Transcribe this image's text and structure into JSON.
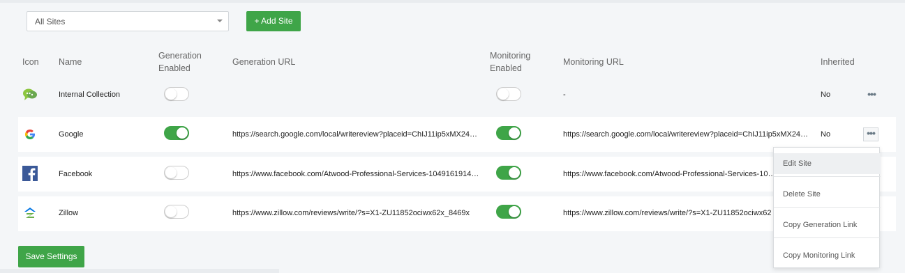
{
  "filter": {
    "selected": "All Sites"
  },
  "toolbar": {
    "add_site_label": "+ Add Site",
    "save_label": "Save Settings"
  },
  "columns": {
    "icon": "Icon",
    "name": "Name",
    "gen_enabled_1": "Generation",
    "gen_enabled_2": "Enabled",
    "gen_url": "Generation URL",
    "mon_enabled_1": "Monitoring",
    "mon_enabled_2": "Enabled",
    "mon_url": "Monitoring URL",
    "inherited": "Inherited"
  },
  "rows": [
    {
      "name": "Internal Collection",
      "icon": "chat-bubbles-icon",
      "generation_enabled": false,
      "generation_url": "",
      "monitoring_enabled": false,
      "monitoring_url": "-",
      "inherited": "No"
    },
    {
      "name": "Google",
      "icon": "google-icon",
      "generation_enabled": true,
      "generation_url": "https://search.google.com/local/writereview?placeid=ChIJ11ip5xMX24…",
      "monitoring_enabled": true,
      "monitoring_url": "https://search.google.com/local/writereview?placeid=ChIJ11ip5xMX24…",
      "inherited": "No"
    },
    {
      "name": "Facebook",
      "icon": "facebook-icon",
      "generation_enabled": false,
      "generation_url": "https://www.facebook.com/Atwood-Professional-Services-1049161914…",
      "monitoring_enabled": true,
      "monitoring_url": "https://www.facebook.com/Atwood-Professional-Services-10…",
      "inherited": ""
    },
    {
      "name": "Zillow",
      "icon": "zillow-icon",
      "generation_enabled": false,
      "generation_url": "https://www.zillow.com/reviews/write/?s=X1-ZU11852ociwx62x_8469x",
      "monitoring_enabled": true,
      "monitoring_url": "https://www.zillow.com/reviews/write/?s=X1-ZU11852ociwx62",
      "inherited": ""
    }
  ],
  "more_glyph": "•••",
  "menu": {
    "items": [
      "Edit Site",
      "Delete Site",
      "Copy Generation Link",
      "Copy Monitoring Link"
    ],
    "hovered": "Edit Site"
  },
  "colors": {
    "accent_green": "#3fa548",
    "facebook_blue": "#3b5998"
  }
}
